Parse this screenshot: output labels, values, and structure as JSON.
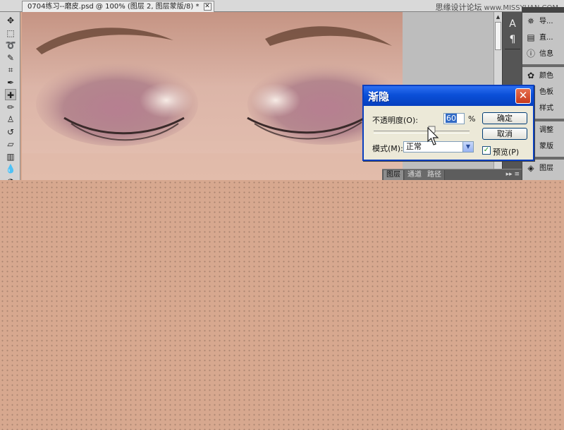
{
  "document_tab": {
    "title": "0704练习--磨皮.psd @ 100% (图层 2, 图层蒙版/8) *",
    "close": "✕"
  },
  "watermark": {
    "cn": "思缘设计论坛",
    "site": "www.MISSYUAN.COM"
  },
  "tools": [
    {
      "name": "move-tool",
      "glyph": "✥"
    },
    {
      "name": "marquee-tool",
      "glyph": "⬚"
    },
    {
      "name": "lasso-tool",
      "glyph": "➰"
    },
    {
      "name": "quick-select-tool",
      "glyph": "✎"
    },
    {
      "name": "crop-tool",
      "glyph": "⌗"
    },
    {
      "name": "eyedropper-tool",
      "glyph": "✒"
    },
    {
      "name": "healing-brush-tool",
      "glyph": "✚"
    },
    {
      "name": "brush-tool",
      "glyph": "✏"
    },
    {
      "name": "clone-stamp-tool",
      "glyph": "♙"
    },
    {
      "name": "history-brush-tool",
      "glyph": "↺"
    },
    {
      "name": "eraser-tool",
      "glyph": "▱"
    },
    {
      "name": "gradient-tool",
      "glyph": "▥"
    },
    {
      "name": "blur-tool",
      "glyph": "💧"
    },
    {
      "name": "dodge-tool",
      "glyph": "◔"
    }
  ],
  "dialog": {
    "title": "渐隐",
    "close": "✕",
    "opacity_label": "不透明度(O):",
    "opacity_value": "60",
    "opacity_unit": "%",
    "opacity_percent": 60,
    "mode_label": "模式(M):",
    "mode_value": "正常",
    "ok_label": "确定",
    "cancel_label": "取消",
    "preview_label": "预览(P)",
    "preview_checked": true
  },
  "layers_tabs": [
    "图层",
    "通道",
    "路径"
  ],
  "layers_menu": "▸▸ ≡",
  "icon_column": [
    {
      "name": "character-icon",
      "glyph": "A"
    },
    {
      "name": "paragraph-icon",
      "glyph": "¶"
    }
  ],
  "right_panel": {
    "group1": [
      {
        "name": "navigator",
        "icon": "navigator-icon",
        "glyph": "✵",
        "label": "导..."
      },
      {
        "name": "histogram",
        "icon": "histogram-icon",
        "glyph": "▤",
        "label": "直..."
      },
      {
        "name": "info",
        "icon": "info-icon",
        "glyph": "ⓘ",
        "label": "信息"
      }
    ],
    "group2": [
      {
        "name": "color",
        "icon": "color-icon",
        "glyph": "✿",
        "label": "颜色"
      },
      {
        "name": "swatches",
        "icon": "swatches-icon",
        "glyph": "▦",
        "label": "色板"
      },
      {
        "name": "styles",
        "icon": "styles-icon",
        "glyph": "▩",
        "label": "样式"
      }
    ],
    "group3": [
      {
        "name": "adjustments",
        "icon": "adjustments-icon",
        "glyph": "◑",
        "label": "调整"
      },
      {
        "name": "masks",
        "icon": "masks-icon",
        "glyph": "◙",
        "label": "蒙版"
      }
    ],
    "group4": [
      {
        "name": "layers",
        "icon": "layers-icon",
        "glyph": "◈",
        "label": "图层"
      }
    ]
  },
  "colors": {
    "skin": "#d7a88f",
    "dialog_title": "#0a4fd8",
    "close_red": "#c6391c"
  }
}
